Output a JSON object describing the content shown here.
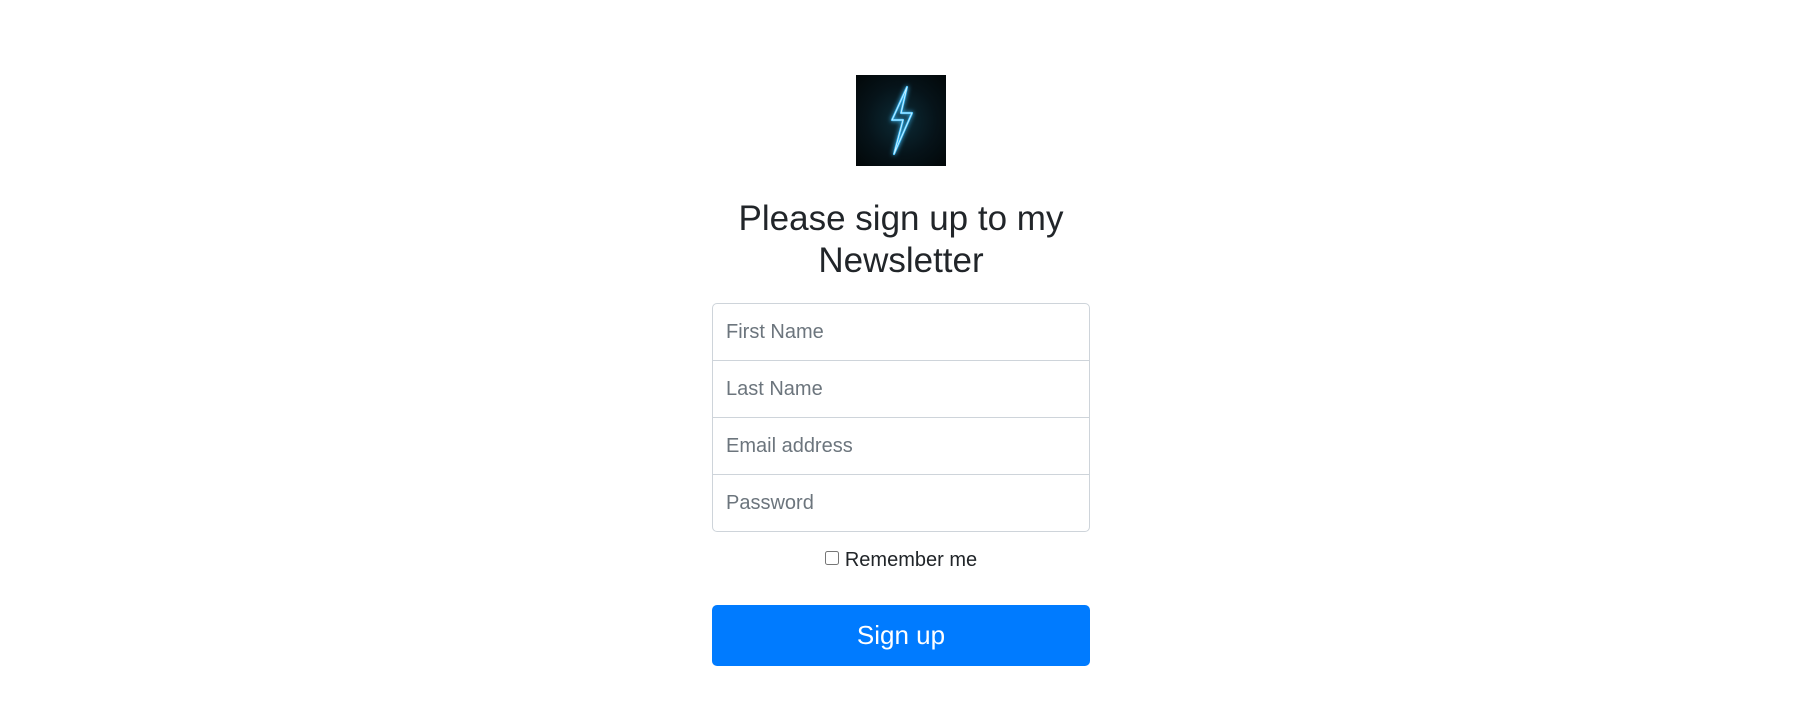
{
  "logo": {
    "icon": "lightning-bolt-icon",
    "colors": {
      "background": "#051116",
      "bolt": "#3fc1ff"
    }
  },
  "form": {
    "title": "Please sign up to my Newsletter",
    "first_name_placeholder": "First Name",
    "last_name_placeholder": "Last Name",
    "email_placeholder": "Email address",
    "password_placeholder": "Password",
    "remember_label": "Remember me",
    "remember_checked": false,
    "submit_label": "Sign up"
  },
  "colors": {
    "accent": "#007bff",
    "border": "#ced4da",
    "text": "#212529"
  }
}
